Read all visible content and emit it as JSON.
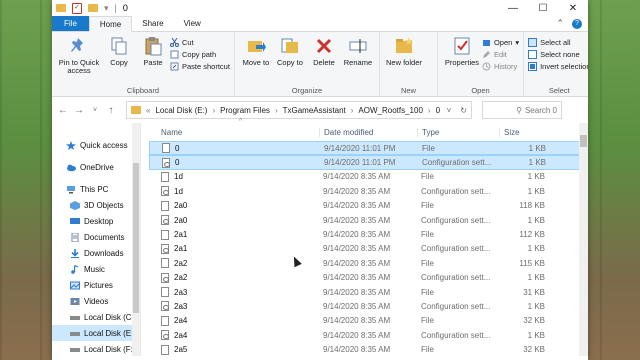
{
  "window": {
    "title": "0",
    "controls": [
      "—",
      "☐",
      "✕"
    ]
  },
  "ribbon_tabs": {
    "file": "File",
    "home": "Home",
    "share": "Share",
    "view": "View"
  },
  "ribbon": {
    "clipboard": {
      "label": "Clipboard",
      "pin": "Pin to Quick access",
      "copy": "Copy",
      "paste": "Paste",
      "cut": "Cut",
      "copy_path": "Copy path",
      "paste_shortcut": "Paste shortcut"
    },
    "organize": {
      "label": "Organize",
      "move_to": "Move to",
      "copy_to": "Copy to",
      "delete": "Delete",
      "rename": "Rename"
    },
    "new": {
      "label": "New",
      "new_folder": "New folder"
    },
    "open": {
      "label": "Open",
      "properties": "Properties",
      "open": "Open",
      "edit": "Edit",
      "history": "History"
    },
    "select": {
      "label": "Select",
      "select_all": "Select all",
      "select_none": "Select none",
      "invert_selection": "Invert selection"
    }
  },
  "address": {
    "crumbs": [
      "Local Disk (E:)",
      "Program Files",
      "TxGameAssistant",
      "AOW_Rootfs_100",
      "0"
    ],
    "search_placeholder": "Search 0"
  },
  "navpane": {
    "items": [
      {
        "label": "Quick access",
        "icon": "star-icon"
      },
      {
        "label": "OneDrive",
        "icon": "cloud-icon"
      },
      {
        "label": "This PC",
        "icon": "computer-icon"
      },
      {
        "label": "3D Objects",
        "icon": "cube-icon"
      },
      {
        "label": "Desktop",
        "icon": "desktop-icon"
      },
      {
        "label": "Documents",
        "icon": "document-icon"
      },
      {
        "label": "Downloads",
        "icon": "download-icon"
      },
      {
        "label": "Music",
        "icon": "music-icon"
      },
      {
        "label": "Pictures",
        "icon": "picture-icon"
      },
      {
        "label": "Videos",
        "icon": "video-icon"
      },
      {
        "label": "Local Disk (C:)",
        "icon": "drive-icon"
      },
      {
        "label": "Local Disk (E:)",
        "icon": "drive-icon"
      },
      {
        "label": "Local Disk (F:)",
        "icon": "drive-icon"
      }
    ]
  },
  "filelist": {
    "headers": {
      "name": "Name",
      "date": "Date modified",
      "type": "Type",
      "size": "Size"
    },
    "rows": [
      {
        "name": "0",
        "date": "9/14/2020 11:01 PM",
        "type": "File",
        "size": "1 KB",
        "cfg": false
      },
      {
        "name": "0",
        "date": "9/14/2020 11:01 PM",
        "type": "Configuration sett...",
        "size": "1 KB",
        "cfg": true
      },
      {
        "name": "1d",
        "date": "9/14/2020 8:35 AM",
        "type": "File",
        "size": "1 KB",
        "cfg": false
      },
      {
        "name": "1d",
        "date": "9/14/2020 8:35 AM",
        "type": "Configuration sett...",
        "size": "1 KB",
        "cfg": true
      },
      {
        "name": "2a0",
        "date": "9/14/2020 8:35 AM",
        "type": "File",
        "size": "118 KB",
        "cfg": false
      },
      {
        "name": "2a0",
        "date": "9/14/2020 8:35 AM",
        "type": "Configuration sett...",
        "size": "1 KB",
        "cfg": true
      },
      {
        "name": "2a1",
        "date": "9/14/2020 8:35 AM",
        "type": "File",
        "size": "112 KB",
        "cfg": false
      },
      {
        "name": "2a1",
        "date": "9/14/2020 8:35 AM",
        "type": "Configuration sett...",
        "size": "1 KB",
        "cfg": true
      },
      {
        "name": "2a2",
        "date": "9/14/2020 8:35 AM",
        "type": "File",
        "size": "115 KB",
        "cfg": false
      },
      {
        "name": "2a2",
        "date": "9/14/2020 8:35 AM",
        "type": "Configuration sett...",
        "size": "1 KB",
        "cfg": true
      },
      {
        "name": "2a3",
        "date": "9/14/2020 8:35 AM",
        "type": "File",
        "size": "31 KB",
        "cfg": false
      },
      {
        "name": "2a3",
        "date": "9/14/2020 8:35 AM",
        "type": "Configuration sett...",
        "size": "1 KB",
        "cfg": true
      },
      {
        "name": "2a4",
        "date": "9/14/2020 8:35 AM",
        "type": "File",
        "size": "32 KB",
        "cfg": false
      },
      {
        "name": "2a4",
        "date": "9/14/2020 8:35 AM",
        "type": "Configuration sett...",
        "size": "1 KB",
        "cfg": true
      },
      {
        "name": "2a5",
        "date": "9/14/2020 8:35 AM",
        "type": "File",
        "size": "32 KB",
        "cfg": false
      }
    ]
  },
  "colors": {
    "accent": "#1979ca",
    "selection": "#cce8ff"
  }
}
